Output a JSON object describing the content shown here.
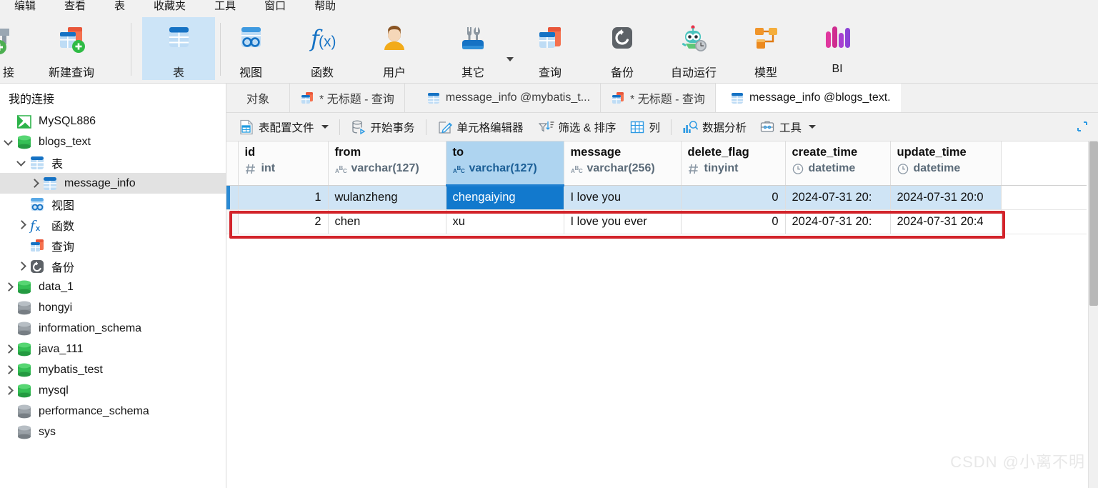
{
  "menubar": {
    "items": [
      {
        "label": "编辑"
      },
      {
        "label": "查看"
      },
      {
        "label": "表"
      },
      {
        "label": "收藏夹"
      },
      {
        "label": "工具"
      },
      {
        "label": "窗口"
      },
      {
        "label": "帮助"
      }
    ]
  },
  "ribbon": {
    "items": [
      {
        "label": "接",
        "icon": "new-connection-icon",
        "selected": false
      },
      {
        "label": "新建查询",
        "icon": "new-query-icon",
        "selected": false
      },
      {
        "label": "表",
        "icon": "table-icon",
        "selected": true
      },
      {
        "label": "视图",
        "icon": "view-icon",
        "selected": false
      },
      {
        "label": "函数",
        "icon": "function-icon",
        "selected": false
      },
      {
        "label": "用户",
        "icon": "user-icon",
        "selected": false
      },
      {
        "label": "其它",
        "icon": "other-tools-icon",
        "selected": false
      },
      {
        "label": "查询",
        "icon": "query-icon",
        "selected": false
      },
      {
        "label": "备份",
        "icon": "backup-icon",
        "selected": false
      },
      {
        "label": "自动运行",
        "icon": "automation-robot-icon",
        "selected": false
      },
      {
        "label": "模型",
        "icon": "model-icon",
        "selected": false
      },
      {
        "label": "BI",
        "icon": "bi-icon",
        "selected": false
      }
    ]
  },
  "sidebar": {
    "title": "我的连接",
    "tree": [
      {
        "label": "MySQL886",
        "icon": "mysql-connection-icon",
        "indent": 0,
        "chevron": "none",
        "selected": false
      },
      {
        "label": "blogs_text",
        "icon": "database-open-icon",
        "indent": 0,
        "chevron": "down",
        "selected": false
      },
      {
        "label": "表",
        "icon": "table-icon",
        "indent": 1,
        "chevron": "down",
        "selected": false
      },
      {
        "label": "message_info",
        "icon": "table-icon",
        "indent": 2,
        "chevron": "right",
        "selected": true
      },
      {
        "label": "视图",
        "icon": "view-icon",
        "indent": 1,
        "chevron": "none",
        "selected": false
      },
      {
        "label": "函数",
        "icon": "function-icon",
        "indent": 1,
        "chevron": "right",
        "selected": false
      },
      {
        "label": "查询",
        "icon": "query-icon",
        "indent": 1,
        "chevron": "none",
        "selected": false
      },
      {
        "label": "备份",
        "icon": "backup-icon",
        "indent": 1,
        "chevron": "right",
        "selected": false
      },
      {
        "label": "data_1",
        "icon": "database-open-icon",
        "indent": 0,
        "chevron": "right",
        "selected": false
      },
      {
        "label": "hongyi",
        "icon": "database-closed-icon",
        "indent": 0,
        "chevron": "none",
        "selected": false
      },
      {
        "label": "information_schema",
        "icon": "database-closed-icon",
        "indent": 0,
        "chevron": "none",
        "selected": false
      },
      {
        "label": "java_111",
        "icon": "database-open-icon",
        "indent": 0,
        "chevron": "right",
        "selected": false
      },
      {
        "label": "mybatis_test",
        "icon": "database-open-icon",
        "indent": 0,
        "chevron": "right",
        "selected": false
      },
      {
        "label": "mysql",
        "icon": "database-open-icon",
        "indent": 0,
        "chevron": "right",
        "selected": false
      },
      {
        "label": "performance_schema",
        "icon": "database-closed-icon",
        "indent": 0,
        "chevron": "none",
        "selected": false
      },
      {
        "label": "sys",
        "icon": "database-closed-icon",
        "indent": 0,
        "chevron": "none",
        "selected": false
      }
    ]
  },
  "tabstrip": {
    "tabs": [
      {
        "label": "对象",
        "icon": "none",
        "active": false
      },
      {
        "label": "* 无标题 - 查询",
        "icon": "query-icon",
        "active": false
      },
      {
        "label": "message_info @mybatis_t...",
        "icon": "table-icon",
        "active": false
      },
      {
        "label": "* 无标题 - 查询",
        "icon": "query-icon",
        "active": false
      },
      {
        "label": "message_info @blogs_text.",
        "icon": "table-icon",
        "active": true
      }
    ]
  },
  "toolbar": {
    "buttons": [
      {
        "label": "表配置文件",
        "icon": "table-profile-icon",
        "caret": true
      },
      {
        "label": "开始事务",
        "icon": "begin-transaction-icon",
        "caret": false
      },
      {
        "label": "单元格编辑器",
        "icon": "cell-editor-pencil-icon",
        "caret": false
      },
      {
        "label": "筛选 & 排序",
        "icon": "filter-sort-icon",
        "caret": false
      },
      {
        "label": "列",
        "icon": "columns-grid-icon",
        "caret": false
      },
      {
        "label": "数据分析",
        "icon": "data-analysis-icon",
        "caret": false
      },
      {
        "label": "工具",
        "icon": "tools-briefcase-icon",
        "caret": true
      }
    ],
    "expand_icon": "expand-corner-icon"
  },
  "grid": {
    "columns": [
      {
        "name": "id",
        "type": "int",
        "type_icon": "number-hash-icon",
        "width": 126,
        "align": "right",
        "highlight": false
      },
      {
        "name": "from",
        "type": "varchar(127)",
        "type_icon": "text-abc-icon",
        "width": 165,
        "align": "left",
        "highlight": false
      },
      {
        "name": "to",
        "type": "varchar(127)",
        "type_icon": "text-abc-icon",
        "width": 165,
        "align": "left",
        "highlight": true
      },
      {
        "name": "message",
        "type": "varchar(256)",
        "type_icon": "text-abc-icon",
        "width": 164,
        "align": "left",
        "highlight": false
      },
      {
        "name": "delete_flag",
        "type": "tinyint",
        "type_icon": "number-hash-icon",
        "width": 146,
        "align": "right",
        "highlight": false
      },
      {
        "name": "create_time",
        "type": "datetime",
        "type_icon": "clock-icon",
        "width": 147,
        "align": "left",
        "highlight": false
      },
      {
        "name": "update_time",
        "type": "datetime",
        "type_icon": "clock-icon",
        "width": 155,
        "align": "left",
        "highlight": false
      }
    ],
    "rows": [
      {
        "selected": true,
        "active_cell": 2,
        "cells": [
          "1",
          "wulanzheng",
          "chengaiying",
          "I love you",
          "0",
          "2024-07-31 20:",
          "2024-07-31 20:0"
        ]
      },
      {
        "selected": false,
        "active_cell": -1,
        "cells": [
          "2",
          "chen",
          "xu",
          "I love you ever",
          "0",
          "2024-07-31 20:",
          "2024-07-31 20:4"
        ]
      }
    ]
  },
  "annotation": {
    "color": "#d2232a",
    "target_row_index": 1
  },
  "watermark": {
    "text": "CSDN @小离不明"
  },
  "colors": {
    "accent": "#1279cd",
    "selection": "#cfe4f5",
    "header_highlight": "#aed4f0",
    "ribbon_selected": "#cce4f7",
    "annotation_red": "#d2232a"
  }
}
